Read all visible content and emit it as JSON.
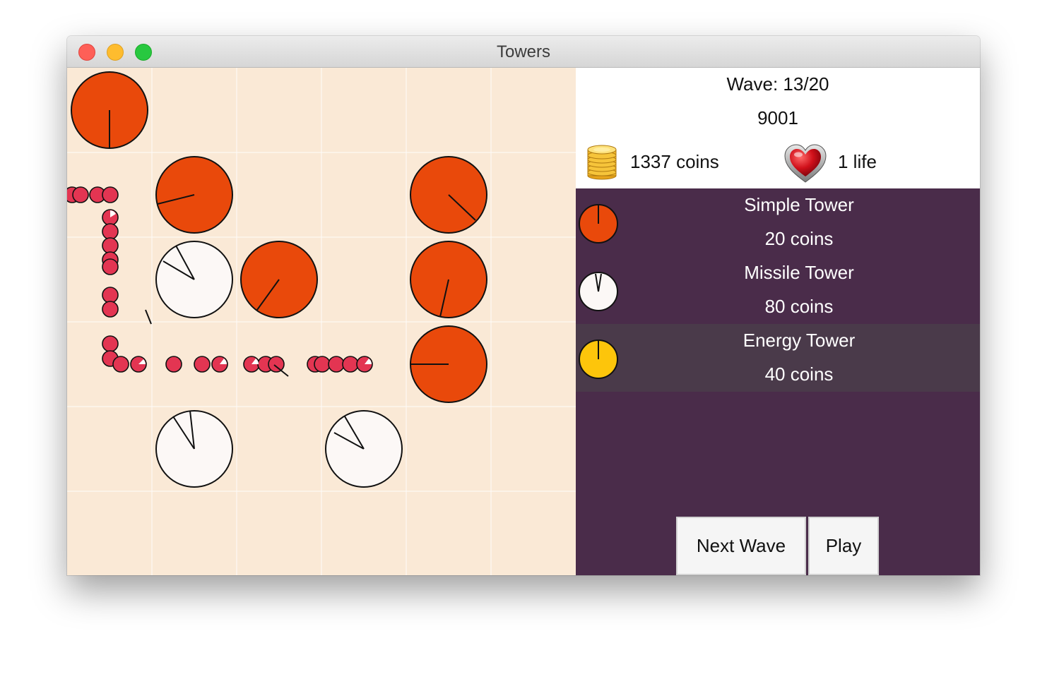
{
  "window": {
    "title": "Towers"
  },
  "status": {
    "wave": "Wave: 13/20",
    "score": "9001",
    "coins": "1337 coins",
    "lives": "1 life",
    "coin_icon": "coin-stack-icon",
    "life_icon": "heart-icon"
  },
  "shop": {
    "items": [
      {
        "name": "Simple Tower",
        "cost": "20 coins",
        "color": "#e9490b",
        "icon": "simple-tower-icon",
        "selected": false
      },
      {
        "name": "Missile Tower",
        "cost": "80 coins",
        "color": "#fcf8f6",
        "icon": "missile-tower-icon",
        "selected": false
      },
      {
        "name": "Energy Tower",
        "cost": "40 coins",
        "color": "#fdc50b",
        "icon": "energy-tower-icon",
        "selected": true
      }
    ]
  },
  "controls": {
    "next_wave": "Next Wave",
    "play": "Play"
  },
  "colors": {
    "board": "#fae9d6",
    "grid": "#ffffff",
    "panel": "#4a2c4a",
    "simple_tower": "#e9490b",
    "missile_tower": "#fcf8f6",
    "energy_tower": "#fdc50b",
    "enemy": "#e33552"
  }
}
